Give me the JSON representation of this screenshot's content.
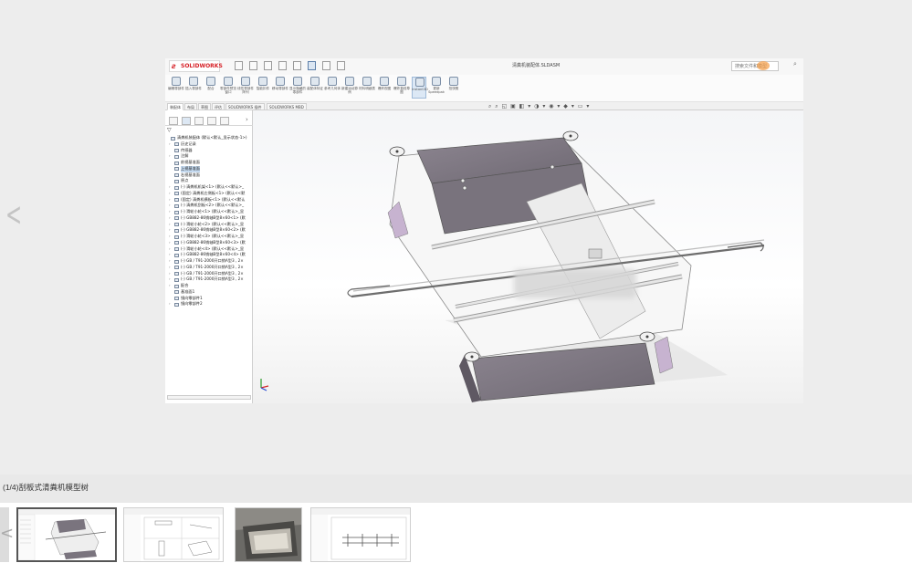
{
  "viewer": {
    "prev_arrow": "<",
    "solidworks": {
      "logo_ds": "ƨ",
      "logo_brand": "SOLIDWORKS",
      "window_title": "清粪机装配体.SLDASM",
      "search_placeholder": "搜索文件和模型",
      "ribbon": [
        {
          "label": "编辑零部件",
          "icon": "edit-component-icon"
        },
        {
          "label": "插入零部件",
          "icon": "insert-component-icon"
        },
        {
          "label": "配合",
          "icon": "mate-icon"
        },
        {
          "label": "零部件预览窗口",
          "icon": "preview-icon"
        },
        {
          "label": "线性零部件阵列",
          "icon": "pattern-icon"
        },
        {
          "label": "智能扣件",
          "icon": "fastener-icon"
        },
        {
          "label": "移动零部件",
          "icon": "move-icon"
        },
        {
          "label": "显示隐藏的零部件",
          "icon": "show-hidden-icon"
        },
        {
          "label": "装配体特征",
          "icon": "assembly-feature-icon"
        },
        {
          "label": "参考几何体",
          "icon": "reference-geometry-icon"
        },
        {
          "label": "新建运动算例",
          "icon": "motion-study-icon"
        },
        {
          "label": "材料明细表",
          "icon": "bom-icon"
        },
        {
          "label": "爆炸视图",
          "icon": "explode-icon"
        },
        {
          "label": "爆炸直线草图",
          "icon": "explode-sketch-icon"
        },
        {
          "label": "Instant3D",
          "icon": "instant3d-icon",
          "active": true
        },
        {
          "label": "更新Speedpak",
          "icon": "speedpak-icon"
        },
        {
          "label": "拍快照",
          "icon": "snapshot-icon"
        }
      ],
      "command_tabs": [
        "装配体",
        "布局",
        "草图",
        "评估",
        "SOLIDWORKS 插件",
        "SOLIDWORKS MBD"
      ],
      "active_tab": 0,
      "tree": [
        {
          "label": "清粪机装配体 (默认<默认_显示状态-1>)",
          "indent": 0,
          "expand": "",
          "icon": "assembly-icon"
        },
        {
          "label": "历史记录",
          "indent": 1,
          "expand": "›",
          "icon": "history-icon"
        },
        {
          "label": "传感器",
          "indent": 1,
          "expand": "",
          "icon": "sensor-icon"
        },
        {
          "label": "注解",
          "indent": 1,
          "expand": "›",
          "icon": "annotation-icon"
        },
        {
          "label": "前视基准面",
          "indent": 1,
          "expand": "",
          "icon": "plane-icon"
        },
        {
          "label": "上视基准面",
          "indent": 1,
          "expand": "",
          "icon": "plane-icon",
          "selected": true
        },
        {
          "label": "右视基准面",
          "indent": 1,
          "expand": "",
          "icon": "plane-icon"
        },
        {
          "label": "原点",
          "indent": 1,
          "expand": "",
          "icon": "origin-icon"
        },
        {
          "label": "(-) 清粪机机架<1> (默认<<默认>_",
          "indent": 1,
          "expand": "›",
          "icon": "part-icon"
        },
        {
          "label": "(固定) 清粪机左侧板<1> (默认<<默",
          "indent": 1,
          "expand": "›",
          "icon": "part-icon"
        },
        {
          "label": "(固定) 清粪机横板<1> (默认<<默认",
          "indent": 1,
          "expand": "›",
          "icon": "part-icon"
        },
        {
          "label": "(-) 清粪机刮板<2> (默认<<默认>_",
          "indent": 1,
          "expand": "›",
          "icon": "part-icon"
        },
        {
          "label": "(-) 滑轮小轮<1> (默认<<默认>_显",
          "indent": 1,
          "expand": "›",
          "icon": "part-icon"
        },
        {
          "label": "(-) GB882-86销轴B型8×60<1> (默",
          "indent": 1,
          "expand": "›",
          "icon": "part-icon"
        },
        {
          "label": "(-) 滑轮小轮<2> (默认<<默认>_显",
          "indent": 1,
          "expand": "›",
          "icon": "part-icon"
        },
        {
          "label": "(-) GB882-86销轴B型8×60<2> (默",
          "indent": 1,
          "expand": "›",
          "icon": "part-icon"
        },
        {
          "label": "(-) 滑轮小轮<3> (默认<<默认>_显",
          "indent": 1,
          "expand": "›",
          "icon": "part-icon"
        },
        {
          "label": "(-) GB882-86销轴B型8×60<3> (默",
          "indent": 1,
          "expand": "›",
          "icon": "part-icon"
        },
        {
          "label": "(-) 滑轮小轮<4> (默认<<默认>_显",
          "indent": 1,
          "expand": "›",
          "icon": "part-icon"
        },
        {
          "label": "(-) GB882-86销轴B型8×60<4> (默",
          "indent": 1,
          "expand": "›",
          "icon": "part-icon"
        },
        {
          "label": "(-) GB / T91-2000开口销A型3 , 2×",
          "indent": 1,
          "expand": "›",
          "icon": "part-icon"
        },
        {
          "label": "(-) GB / T91-2000开口销A型3 , 2×",
          "indent": 1,
          "expand": "›",
          "icon": "part-icon"
        },
        {
          "label": "(-) GB / T91-2000开口销A型3 , 2×",
          "indent": 1,
          "expand": "›",
          "icon": "part-icon"
        },
        {
          "label": "(-) GB / T91-2000开口销A型3 , 2×",
          "indent": 1,
          "expand": "›",
          "icon": "part-icon"
        },
        {
          "label": "配合",
          "indent": 1,
          "expand": "›",
          "icon": "mates-folder-icon"
        },
        {
          "label": "基准面1",
          "indent": 1,
          "expand": "",
          "icon": "plane-icon"
        },
        {
          "label": "镜向零部件1",
          "indent": 1,
          "expand": "",
          "icon": "mirror-icon"
        },
        {
          "label": "镜向零部件2",
          "indent": 1,
          "expand": "›",
          "icon": "mirror-icon"
        }
      ]
    }
  },
  "caption": "(1/4)刮板式清粪机模型树",
  "thumbnails": [
    {
      "name": "thumbnail-1",
      "kind": "assembly-iso",
      "active": true
    },
    {
      "name": "thumbnail-2",
      "kind": "drawing"
    },
    {
      "name": "thumbnail-3",
      "kind": "photo"
    },
    {
      "name": "thumbnail-4",
      "kind": "drawing-front"
    }
  ],
  "strip_prev": "<"
}
